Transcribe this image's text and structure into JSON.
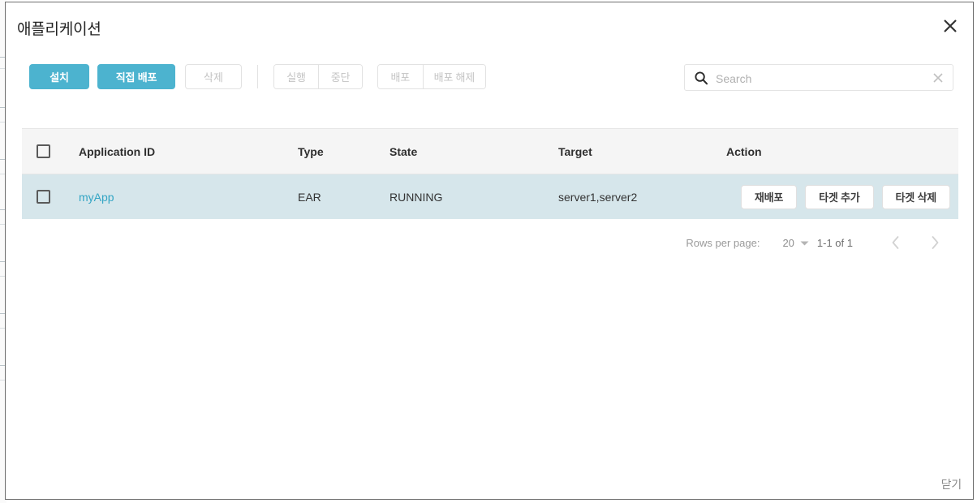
{
  "dialog": {
    "title": "애플리케이션",
    "close_icon": "close-icon",
    "footer_close_label": "닫기"
  },
  "toolbar": {
    "install_label": "설치",
    "deploy_direct_label": "직접 배포",
    "delete_label": "삭제",
    "start_label": "실행",
    "stop_label": "중단",
    "deploy_label": "배포",
    "undeploy_label": "배포 해제"
  },
  "search": {
    "placeholder": "Search",
    "value": "",
    "icon": "search-icon",
    "clear_icon": "close-icon"
  },
  "table": {
    "columns": [
      "Application ID",
      "Type",
      "State",
      "Target",
      "Action"
    ],
    "rows": [
      {
        "checked": false,
        "application_id": "myApp",
        "type": "EAR",
        "state": "RUNNING",
        "target": "server1,server2",
        "actions": [
          "재배포",
          "타겟 추가",
          "타겟 삭제"
        ]
      }
    ]
  },
  "pagination": {
    "rows_per_page_label": "Rows per page:",
    "rows_per_page_value": "20",
    "range": "1-1 of 1",
    "prev_icon": "chevron-left-icon",
    "next_icon": "chevron-right-icon"
  },
  "colors": {
    "accent": "#4cb3cf",
    "link": "#33a5c4",
    "row_selected": "#d6e6eb",
    "header_bg": "#f5f5f5"
  }
}
